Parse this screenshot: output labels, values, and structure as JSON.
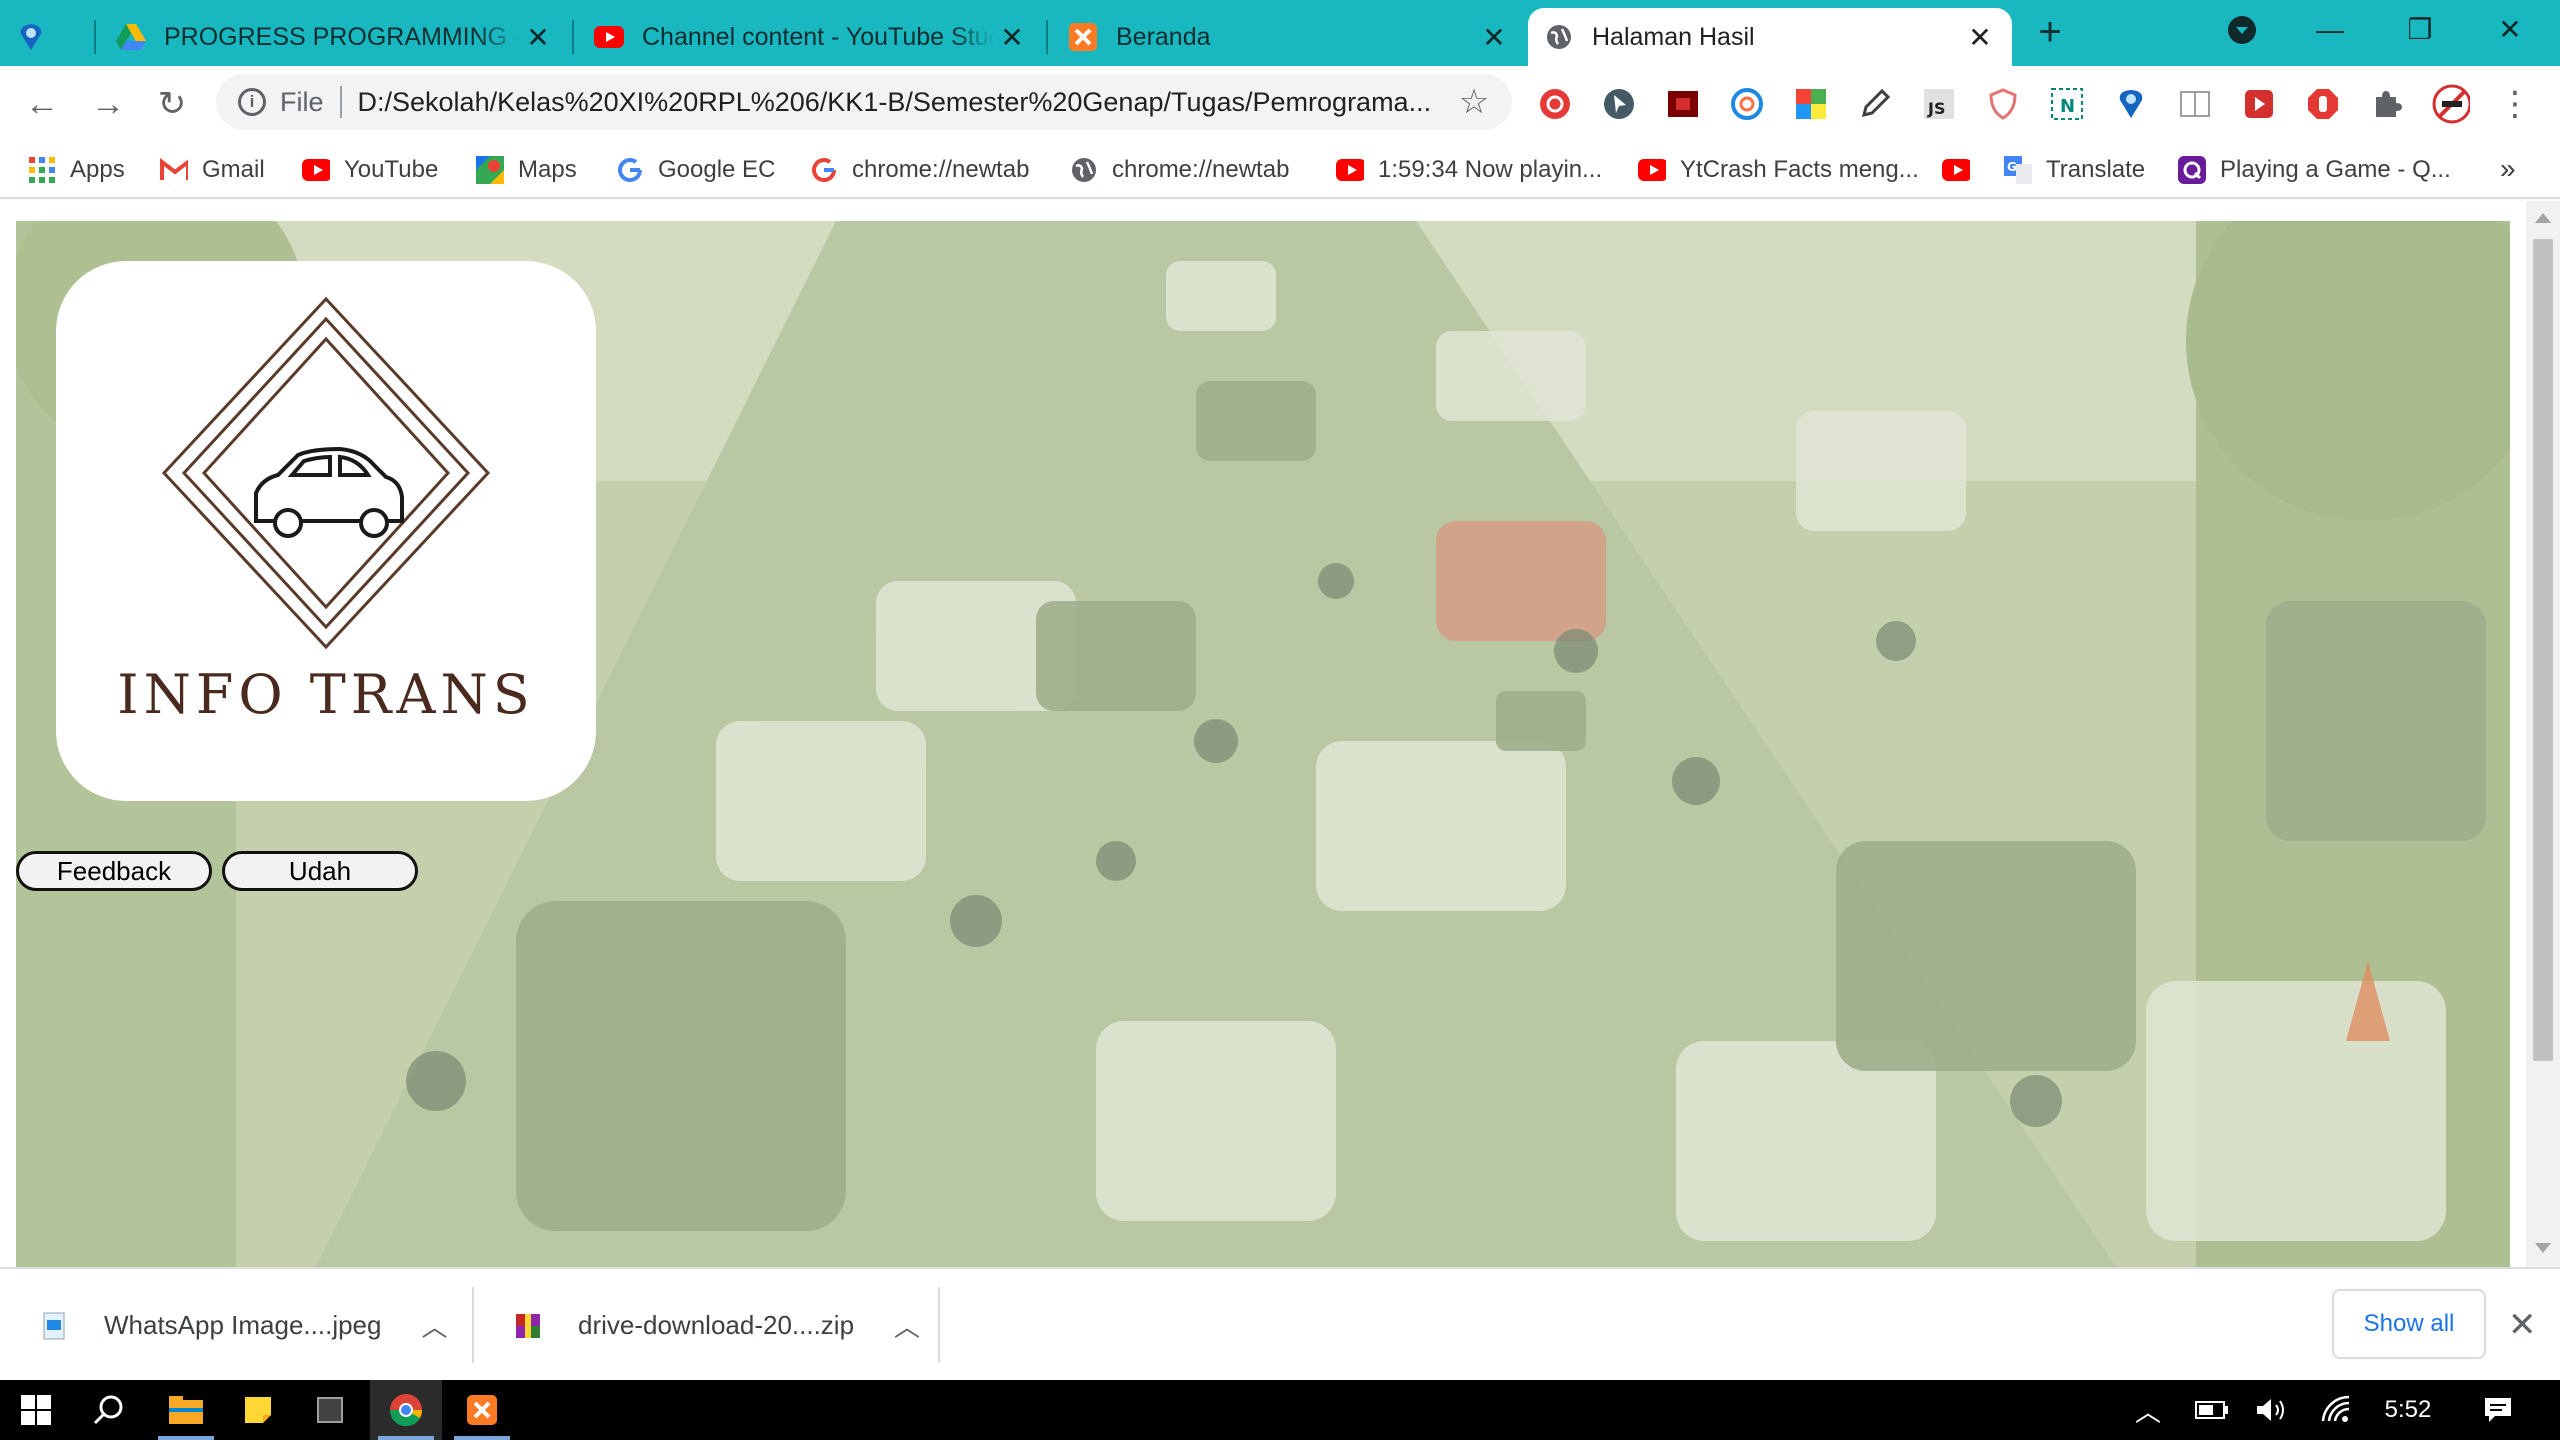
{
  "browser": {
    "tabs": [
      {
        "title": "",
        "icon": "pin-icon"
      },
      {
        "title": "PROGRESS PROGRAMMING - Google Drive",
        "icon": "google-drive-icon"
      },
      {
        "title": "Channel content - YouTube Studio",
        "icon": "youtube-icon"
      },
      {
        "title": "Beranda",
        "icon": "xampp-icon"
      },
      {
        "title": "Halaman Hasil",
        "icon": "globe-icon",
        "active": true
      }
    ],
    "new_tab": "+",
    "address": {
      "scheme": "File",
      "url": "D:/Sekolah/Kelas%20XI%20RPL%206/KK1-B/Semester%20Genap/Tugas/Pemrograma..."
    },
    "bookmarks": [
      {
        "label": "Apps",
        "icon": "apps-grid-icon"
      },
      {
        "label": "Gmail",
        "icon": "gmail-icon"
      },
      {
        "label": "YouTube",
        "icon": "youtube-icon"
      },
      {
        "label": "Maps",
        "icon": "maps-icon"
      },
      {
        "label": "Google EC",
        "icon": "google-icon"
      },
      {
        "label": "chrome://newtab",
        "icon": "google-icon"
      },
      {
        "label": "chrome://newtab",
        "icon": "globe-icon"
      },
      {
        "label": "1:59:34 Now playin...",
        "icon": "youtube-icon"
      },
      {
        "label": "YtCrash Facts meng...",
        "icon": "youtube-icon"
      },
      {
        "label": "",
        "icon": "youtube-icon"
      },
      {
        "label": "Translate",
        "icon": "google-translate-icon"
      },
      {
        "label": "Playing a Game - Q...",
        "icon": "quizizz-icon"
      }
    ],
    "bookmarks_more": "»"
  },
  "page": {
    "logo_text": "INFO TRANS",
    "buttons": [
      {
        "label": "Feedback"
      },
      {
        "label": "Udah"
      }
    ],
    "hero_image": "traffic-jam-photo"
  },
  "downloads": {
    "items": [
      {
        "name": "WhatsApp Image....jpeg",
        "icon": "image-file-icon"
      },
      {
        "name": "drive-download-20....zip",
        "icon": "zip-file-icon"
      }
    ],
    "show_all": "Show all"
  },
  "taskbar": {
    "time": "5:52",
    "pinned": [
      "windows-start-icon",
      "search-icon",
      "file-explorer-icon",
      "sticky-notes-icon",
      "app-window-icon",
      "chrome-icon",
      "xampp-icon"
    ]
  },
  "colors": {
    "tab_strip": "#19b7bf",
    "hero_tint": "#c8d4b2",
    "logo_brown": "#4a2a1f"
  }
}
